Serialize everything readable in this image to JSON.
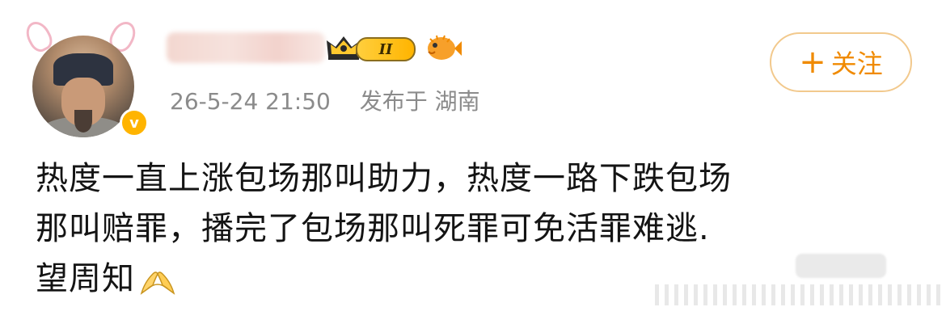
{
  "post": {
    "author": {
      "name": "",
      "level_badge": "II",
      "verified_badge": "v"
    },
    "timestamp": "26-5-24 21:50",
    "posted_from": "发布于 湖南",
    "follow_button": {
      "plus": "+",
      "label": "关注"
    },
    "content": {
      "line1": "热度一直上涨包场那叫助力，热度一路下跌包场",
      "line2": "那叫赔罪，播完了包场那叫死罪可免活罪难逃.",
      "line3": "望周知"
    }
  },
  "icons": {
    "avatar": "avatar-image",
    "crown": "crown-icon",
    "fish": "pufferfish-icon",
    "hands": "pinched-hands-emoji"
  },
  "colors": {
    "accent": "#f08a00",
    "follow_border": "#f2c98d",
    "muted_text": "#8b8b8b",
    "verified": "#ffb400"
  }
}
